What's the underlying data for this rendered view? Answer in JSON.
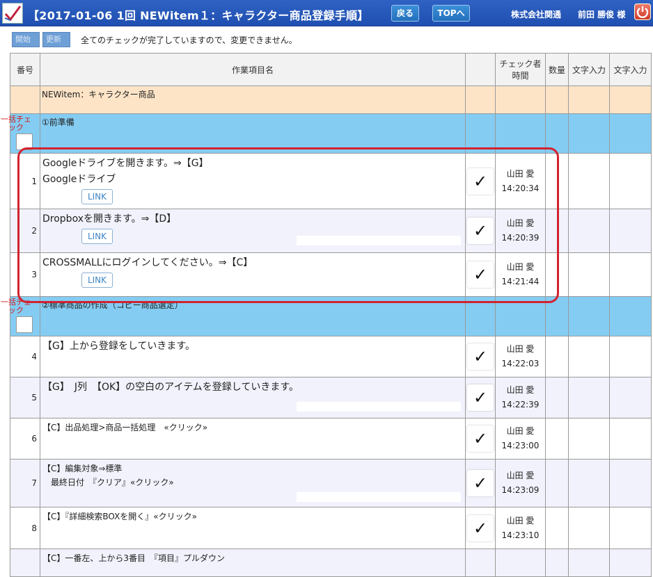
{
  "header": {
    "title": "【2017-01-06 1回 NEWitem１：キャラクター商品登録手順】",
    "back_label": "戻る",
    "top_label": "TOPへ",
    "company": "株式会社関通",
    "user": "前田 勝俊 様",
    "app_icon": "check-logo-icon",
    "power_icon": "power-icon"
  },
  "toolbar": {
    "start_label": "開始",
    "update_label": "更新",
    "notice": "全てのチェックが完了していますので、変更できません。"
  },
  "columns": {
    "no": "番号",
    "name": "作業項目名",
    "checker_line1": "チェック者",
    "checker_line2": "時間",
    "qty": "数量",
    "text1": "文字入力",
    "text2": "文字入力"
  },
  "section_title": "NEWitem：キャラクター商品",
  "bulk_label": "一括チェック",
  "groups": [
    {
      "name": "①前準備"
    },
    {
      "name": "②標準商品の作成（コピー商品選定）"
    }
  ],
  "rows": [
    {
      "no": "1",
      "line1": "Googleドライブを開きます。⇒【G】",
      "line2": "Googleドライブ",
      "link": "LINK",
      "checker": "山田 愛",
      "time": "14:20:34"
    },
    {
      "no": "2",
      "line1": "Dropboxを開きます。⇒【D】",
      "link": "LINK",
      "checker": "山田 愛",
      "time": "14:20:39"
    },
    {
      "no": "3",
      "line1": "CROSSMALLにログインしてください。⇒【C】",
      "link": "LINK",
      "checker": "山田 愛",
      "time": "14:21:44"
    },
    {
      "no": "4",
      "line1": "【G】上から登録をしていきます。",
      "checker": "山田 愛",
      "time": "14:22:03"
    },
    {
      "no": "5",
      "line1": "【G】　J列　【OK】の空白のアイテムを登録していきます。",
      "checker": "山田 愛",
      "time": "14:22:39"
    },
    {
      "no": "6",
      "line1": "【C】出品処理>商品一括処理　«クリック»",
      "checker": "山田 愛",
      "time": "14:23:00"
    },
    {
      "no": "7",
      "line1": "【C】編集対象⇒標準",
      "line2": "　最終日付　『クリア』«クリック»",
      "checker": "山田 愛",
      "time": "14:23:09"
    },
    {
      "no": "8",
      "line1": "【C】『詳細検索BOXを開く』«クリック»",
      "checker": "山田 愛",
      "time": "14:23:10"
    },
    {
      "no": "",
      "line1": "【C】一番左、上から3番目　『項目』プルダウン"
    }
  ],
  "check_mark": "✓"
}
